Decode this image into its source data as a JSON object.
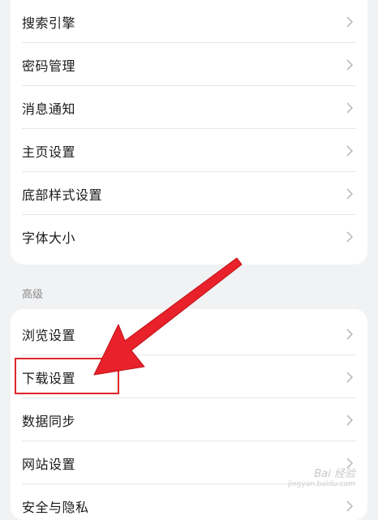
{
  "settings_group_1": {
    "items": [
      {
        "label": "搜索引擎"
      },
      {
        "label": "密码管理"
      },
      {
        "label": "消息通知"
      },
      {
        "label": "主页设置"
      },
      {
        "label": "底部样式设置"
      },
      {
        "label": "字体大小"
      }
    ]
  },
  "advanced_section": {
    "title": "高级",
    "items": [
      {
        "label": "浏览设置"
      },
      {
        "label": "下载设置"
      },
      {
        "label": "数据同步"
      },
      {
        "label": "网站设置"
      },
      {
        "label": "安全与隐私"
      }
    ]
  },
  "annotation": {
    "highlight_color": "#e0262a",
    "arrow_color": "#e8212b"
  },
  "watermark": {
    "logo": "Bai 经验",
    "url": "jingyan.baidu.com"
  }
}
